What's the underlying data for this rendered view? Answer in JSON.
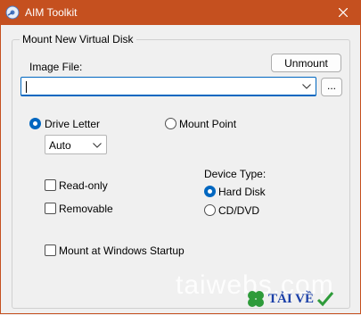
{
  "window": {
    "title": "AIM Toolkit",
    "accent_color": "#c5501f"
  },
  "group": {
    "label": "Mount New Virtual Disk"
  },
  "image_file": {
    "label": "Image File:",
    "value": "",
    "browse_label": "..."
  },
  "unmount_label": "Unmount",
  "mount_type": {
    "drive_letter_label": "Drive Letter",
    "mount_point_label": "Mount Point",
    "selected": "drive_letter",
    "drive_select_value": "Auto"
  },
  "options": {
    "readonly_label": "Read-only",
    "removable_label": "Removable",
    "startup_label": "Mount at Windows Startup"
  },
  "device_type": {
    "label": "Device Type:",
    "hard_disk_label": "Hard Disk",
    "cddvd_label": "CD/DVD",
    "selected": "hard_disk"
  },
  "watermark": {
    "site": "taiwebs.com",
    "download": "TẢI VỀ"
  }
}
